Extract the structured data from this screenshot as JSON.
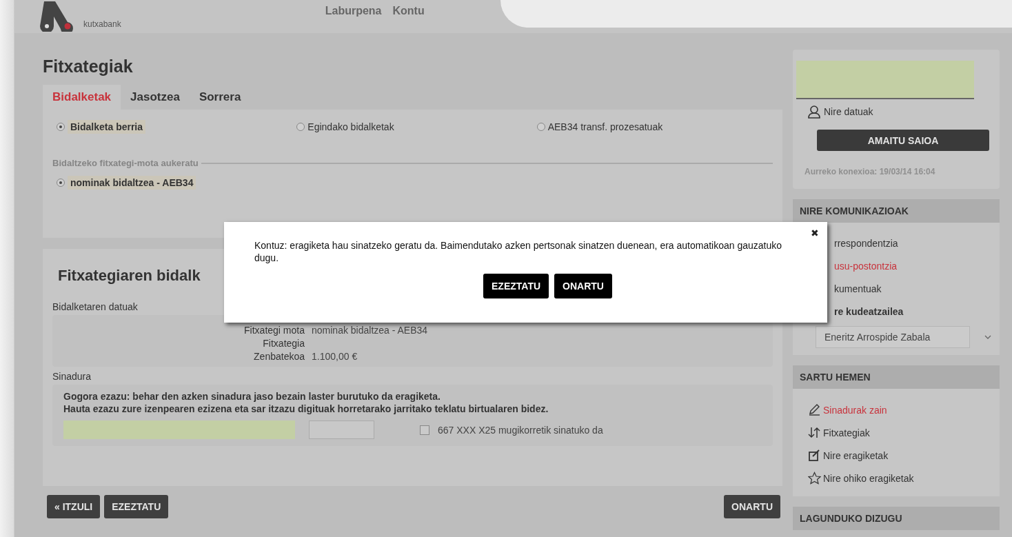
{
  "header": {
    "logo_text": "kutxabank",
    "nav": [
      {
        "label": "Laburpena"
      },
      {
        "label": "Kontu"
      }
    ]
  },
  "page_title": "Fitxategiak",
  "tabs": [
    {
      "label": "Bidalketak",
      "selected": true
    },
    {
      "label": "Jasotzea",
      "selected": false
    },
    {
      "label": "Sorrera",
      "selected": false
    }
  ],
  "send_options": [
    {
      "label": "Bidalketa berria",
      "selected": true
    },
    {
      "label": "Egindako bidalketak",
      "selected": false
    },
    {
      "label": "AEB34 transf. prozesatuak",
      "selected": false
    }
  ],
  "file_type_legend": "Bidaltzeko fitxategi-mota aukeratu",
  "file_types": [
    {
      "label": "nominak bidaltzea - AEB34",
      "selected": true
    }
  ],
  "send_section": {
    "title": "Fitxategiaren bidalk",
    "data_label": "Bidalketaren datuak",
    "fields": [
      {
        "label": "Fitxategi mota",
        "value": "nominak bidaltzea - AEB34"
      },
      {
        "label": "Fitxategia"
      },
      {
        "label": "Zenbatekoa",
        "value": "1.100,00 €"
      }
    ],
    "signature_label": "Sinadura",
    "signature_notes": [
      "Gogora ezazu: behar den azken sinadura jaso bezain laster burutuko da eragiketa.",
      "Hauta ezazu zure izenpearen ezizena eta sar itzazu digituak horretarako jarritako teklatu birtualaren bidez."
    ],
    "mobile_checkbox": {
      "label": "667 XXX X25 mugikorretik sinatuko da",
      "checked": false
    }
  },
  "left_buttons": [
    "« ITZULI",
    "EZEZTATU"
  ],
  "right_buttons": [
    "ONARTU"
  ],
  "sidebar": {
    "my_data": "Nire datuak",
    "logout": "AMAITU SAIOA",
    "last_connection": "Aurreko konexioa: 19/03/14 16:04",
    "comm_title": "NIRE KOMUNIKAZIOAK",
    "comm_items": [
      {
        "label": "rrespondentzia",
        "kind": "link"
      },
      {
        "label": "usu-postontzia",
        "kind": "alert"
      },
      {
        "label": "kumentuak",
        "kind": "link"
      },
      {
        "label": "re kudeatzailea",
        "kind": "heading"
      }
    ],
    "manager": "Eneritz Arrospide Zabala",
    "enter_title": "SARTU HEMEN",
    "enter_items": [
      {
        "label": "Sinadurak zain",
        "kind": "pencil",
        "highlighted": true
      },
      {
        "label": "Fitxategiak",
        "kind": "arrows",
        "highlighted": false
      },
      {
        "label": "Nire eragiketak",
        "kind": "edit",
        "highlighted": false
      },
      {
        "label": "Nire ohiko eragiketak",
        "kind": "star",
        "highlighted": false
      }
    ],
    "help_title": "LAGUNDUKO DIZUGU"
  },
  "modal": {
    "close": "✖",
    "message": "Kontuz: eragiketa hau sinatzeko geratu da. Baimendutako azken pertsonak sinatzen duenean, era automatikoan gauzatuko dugu.",
    "buttons": [
      "EZEZTATU",
      "ONARTU"
    ]
  }
}
